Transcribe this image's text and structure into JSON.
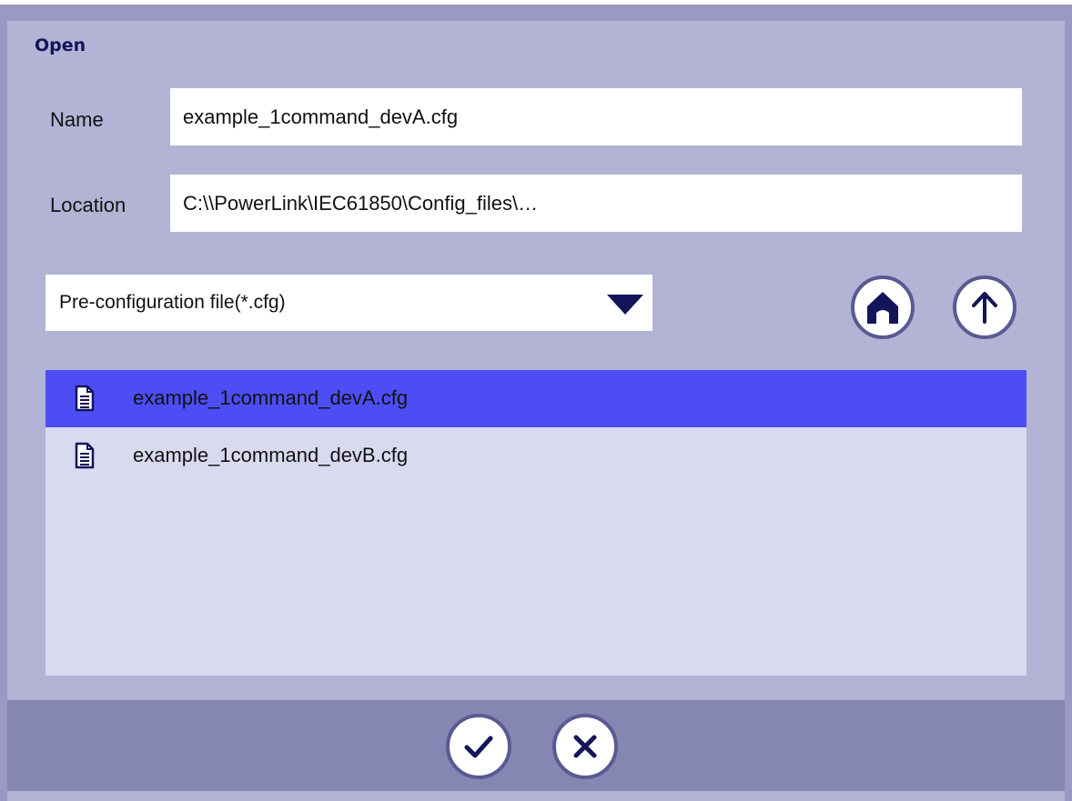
{
  "dialog": {
    "title": "Open"
  },
  "name_field": {
    "label": "Name",
    "value": "example_1command_devA.cfg"
  },
  "location_field": {
    "label": "Location",
    "value": "C:\\\\PowerLink\\IEC61850\\Config_files\\…"
  },
  "file_type": {
    "selected": "Pre-configuration file(*.cfg)"
  },
  "nav": {
    "home_icon": "home-icon",
    "up_icon": "arrow-up-icon"
  },
  "files": [
    {
      "name": "example_1command_devA.cfg",
      "icon": "document-icon",
      "selected": true
    },
    {
      "name": "example_1command_devB.cfg",
      "icon": "document-icon",
      "selected": false
    }
  ],
  "footer": {
    "ok_icon": "checkmark-icon",
    "cancel_icon": "close-icon"
  },
  "colors": {
    "frame": "#9999c4",
    "panel": "#b3b3d6",
    "list_background": "#d9d9f0",
    "selection": "#4d4df5",
    "footer": "#8686b3",
    "accent": "#14145a"
  }
}
